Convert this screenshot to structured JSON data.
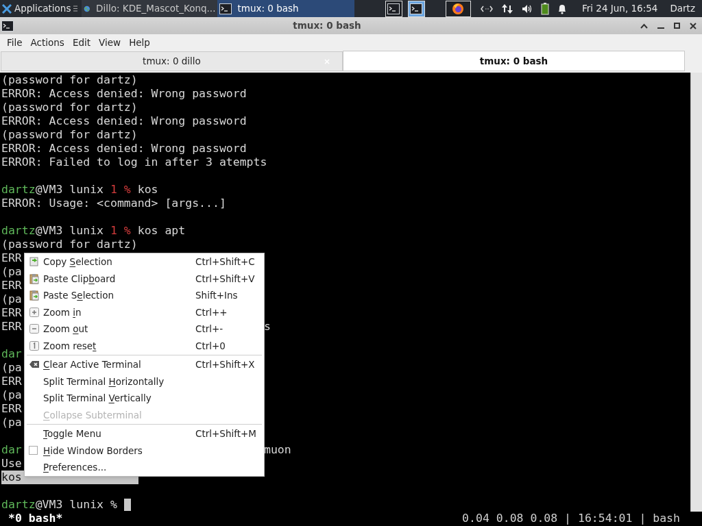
{
  "taskbar": {
    "apps_label": "Applications",
    "tasks": [
      {
        "label": "Dillo: KDE_Mascot_Konq...",
        "kind": "browser",
        "selected": false
      },
      {
        "label": "tmux: 0 bash",
        "kind": "terminal",
        "selected": true
      }
    ],
    "tray_apps": [
      {
        "kind": "terminal",
        "selected": false
      },
      {
        "kind": "terminal",
        "selected": true
      },
      {
        "kind": "firefox",
        "selected": false
      }
    ],
    "clock": "Fri 24 Jun, 16:54",
    "user": "Dartz"
  },
  "window": {
    "title": "tmux: 0 bash"
  },
  "menubar": [
    "File",
    "Actions",
    "Edit",
    "View",
    "Help"
  ],
  "tabs": [
    {
      "label": "tmux: 0 dillo",
      "selected": false
    },
    {
      "label": "tmux: 0 bash",
      "selected": true
    }
  ],
  "terminal": {
    "lines": [
      {
        "kind": "text",
        "segments": [
          {
            "kind": "plain",
            "text": "(password for dartz)"
          }
        ]
      },
      {
        "kind": "text",
        "segments": [
          {
            "kind": "plain",
            "text": "ERROR: Access denied: Wrong password"
          }
        ]
      },
      {
        "kind": "text",
        "segments": [
          {
            "kind": "plain",
            "text": "(password for dartz)"
          }
        ]
      },
      {
        "kind": "text",
        "segments": [
          {
            "kind": "plain",
            "text": "ERROR: Access denied: Wrong password"
          }
        ]
      },
      {
        "kind": "text",
        "segments": [
          {
            "kind": "plain",
            "text": "(password for dartz)"
          }
        ]
      },
      {
        "kind": "text",
        "segments": [
          {
            "kind": "plain",
            "text": "ERROR: Access denied: Wrong password"
          }
        ]
      },
      {
        "kind": "text",
        "segments": [
          {
            "kind": "plain",
            "text": "ERROR: Failed to log in after 3 atempts"
          }
        ]
      },
      {
        "kind": "blank"
      },
      {
        "kind": "text",
        "segments": [
          {
            "kind": "user",
            "text": "dartz"
          },
          {
            "kind": "plain",
            "text": "@VM3 lunix "
          },
          {
            "kind": "status",
            "text": "1 %"
          },
          {
            "kind": "plain",
            "text": " kos"
          }
        ]
      },
      {
        "kind": "text",
        "segments": [
          {
            "kind": "plain",
            "text": "ERROR: Usage: <command> [args...]"
          }
        ]
      },
      {
        "kind": "blank"
      },
      {
        "kind": "text",
        "segments": [
          {
            "kind": "user",
            "text": "dartz"
          },
          {
            "kind": "plain",
            "text": "@VM3 lunix "
          },
          {
            "kind": "status",
            "text": "1 %"
          },
          {
            "kind": "plain",
            "text": " kos apt"
          }
        ]
      },
      {
        "kind": "text",
        "segments": [
          {
            "kind": "plain",
            "text": "(password for dartz)"
          }
        ]
      },
      {
        "kind": "text",
        "segments": [
          {
            "kind": "plain",
            "text": "ERR"
          }
        ]
      },
      {
        "kind": "text",
        "segments": [
          {
            "kind": "plain",
            "text": "(pa"
          }
        ]
      },
      {
        "kind": "text",
        "segments": [
          {
            "kind": "plain",
            "text": "ERR"
          }
        ]
      },
      {
        "kind": "text",
        "segments": [
          {
            "kind": "plain",
            "text": "(pa"
          }
        ]
      },
      {
        "kind": "text",
        "segments": [
          {
            "kind": "plain",
            "text": "ERR"
          }
        ]
      },
      {
        "kind": "text",
        "segments": [
          {
            "kind": "plain",
            "text": "ERR"
          }
        ],
        "tail": "s"
      },
      {
        "kind": "blank"
      },
      {
        "kind": "text",
        "segments": [
          {
            "kind": "user",
            "text": "dar"
          }
        ]
      },
      {
        "kind": "text",
        "segments": [
          {
            "kind": "plain",
            "text": "(pa"
          }
        ]
      },
      {
        "kind": "text",
        "segments": [
          {
            "kind": "plain",
            "text": "ERR"
          }
        ]
      },
      {
        "kind": "text",
        "segments": [
          {
            "kind": "plain",
            "text": "(pa"
          }
        ]
      },
      {
        "kind": "text",
        "segments": [
          {
            "kind": "plain",
            "text": "ERR"
          }
        ]
      },
      {
        "kind": "text",
        "segments": [
          {
            "kind": "plain",
            "text": "(pa"
          }
        ]
      },
      {
        "kind": "blank"
      },
      {
        "kind": "text",
        "segments": [
          {
            "kind": "user",
            "text": "dar"
          }
        ],
        "tail": "muon"
      },
      {
        "kind": "text",
        "segments": [
          {
            "kind": "plain",
            "text": "Use"
          }
        ]
      },
      {
        "kind": "highlight",
        "text": "kos"
      },
      {
        "kind": "blank"
      },
      {
        "kind": "text",
        "segments": [
          {
            "kind": "user",
            "text": "dartz"
          },
          {
            "kind": "plain",
            "text": "@VM3 lunix %"
          }
        ]
      }
    ],
    "cursor_visible": true
  },
  "status_bar": {
    "left": "*0 bash*",
    "right": "0.04 0.08 0.08 | 16:54:01 | bash"
  },
  "context_menu": {
    "items": [
      {
        "kind": "copy",
        "label": {
          "before": "Copy ",
          "key": "S",
          "after": "election"
        },
        "shortcut": "Ctrl+Shift+C",
        "disabled": false
      },
      {
        "kind": "paste",
        "label": {
          "before": "Paste Clip",
          "key": "b",
          "after": "oard"
        },
        "shortcut": "Ctrl+Shift+V",
        "disabled": false
      },
      {
        "kind": "paste",
        "label": {
          "before": "Paste S",
          "key": "e",
          "after": "lection"
        },
        "shortcut": "Shift+Ins",
        "disabled": false
      },
      {
        "kind": "zoomin",
        "label": {
          "before": "Zoom ",
          "key": "i",
          "after": "n"
        },
        "shortcut": "Ctrl++",
        "disabled": false
      },
      {
        "kind": "zoomout",
        "label": {
          "before": "Zoom ",
          "key": "o",
          "after": "ut"
        },
        "shortcut": "Ctrl+-",
        "disabled": false
      },
      {
        "kind": "zoomreset",
        "label": {
          "before": "Zoom rese",
          "key": "t"
        },
        "shortcut": "Ctrl+0",
        "disabled": false
      },
      {
        "kind": "separator"
      },
      {
        "kind": "clear",
        "label": {
          "key": "C",
          "after": "lear Active Terminal"
        },
        "shortcut": "Ctrl+Shift+X",
        "disabled": false
      },
      {
        "kind": "plain",
        "label": {
          "before": "Split Terminal ",
          "key": "H",
          "after": "orizontally"
        },
        "disabled": false
      },
      {
        "kind": "plain",
        "label": {
          "before": "Split Terminal ",
          "key": "V",
          "after": "ertically"
        },
        "disabled": false
      },
      {
        "kind": "plain",
        "label": {
          "key": "C",
          "after": "ollapse Subterminal"
        },
        "disabled": true
      },
      {
        "kind": "separator"
      },
      {
        "kind": "plain",
        "label": {
          "key": "T",
          "after": "oggle Menu"
        },
        "shortcut": "Ctrl+Shift+M",
        "disabled": false
      },
      {
        "kind": "check",
        "label": {
          "key": "H",
          "after": "ide Window Borders"
        },
        "checked": false,
        "disabled": false
      },
      {
        "kind": "plain",
        "label": {
          "key": "P",
          "after": "references..."
        },
        "disabled": false
      }
    ]
  }
}
